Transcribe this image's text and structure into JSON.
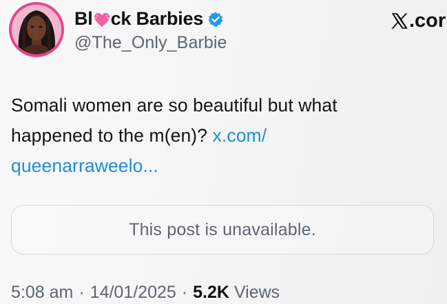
{
  "header": {
    "display_name_before": "Bl",
    "display_name_emoji": "pink-heart-emoji",
    "display_name_after": "ck Barbies",
    "verified_badge_color": "#1d9bf0",
    "handle": "@The_Only_Barbie",
    "avatar_icon": "profile-avatar",
    "brand": {
      "icon": "x-logo-icon",
      "text": ".cor"
    }
  },
  "tweet": {
    "line1": "Somali women are so beautiful but what",
    "line2_text": "happened to the m(en)? ",
    "line2_link": "x.com/",
    "line3_link": "queenarraweelo...",
    "link_color": "#1d8fd6"
  },
  "quote_card": {
    "text": "This post is unavailable."
  },
  "meta": {
    "time": "5:08 am",
    "separator": "·",
    "date": "14/01/2025",
    "views_count": "5.2K",
    "views_label": "Views"
  }
}
